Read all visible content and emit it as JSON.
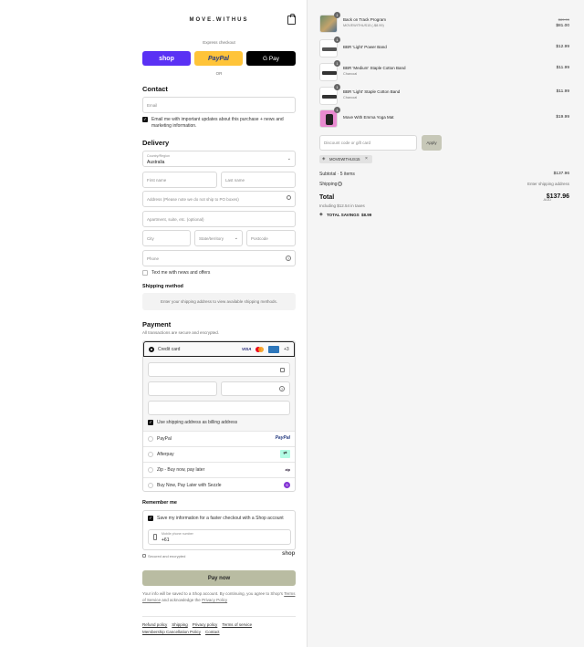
{
  "header": {
    "brand": "MOVE.WITHUS"
  },
  "express": {
    "label": "Express checkout",
    "shop_label": "shop",
    "paypal_label": "PayPal",
    "gpay_label": "G Pay",
    "or_label": "OR"
  },
  "contact": {
    "heading": "Contact",
    "email_placeholder": "Email",
    "news_label": "Email me with important updates about this purchase + news and marketing information."
  },
  "delivery": {
    "heading": "Delivery",
    "country_label": "Country/Region",
    "country_value": "Australia",
    "first_name": "First name",
    "last_name": "Last name",
    "address": "Address (Please note we do not ship to PO boxes)",
    "apartment": "Apartment, suite, etc. (optional)",
    "city": "City",
    "state": "State/territory",
    "postcode": "Postcode",
    "phone": "Phone",
    "text_label": "Text me with news and offers"
  },
  "shipping": {
    "heading": "Shipping method",
    "message": "Enter your shipping address to view available shipping methods."
  },
  "payment": {
    "heading": "Payment",
    "subtext": "All transactions are secure and encrypted.",
    "credit_card": "Credit card",
    "visa": "VISA",
    "more": "+3",
    "billing_label": "Use shipping address as billing address",
    "options": [
      {
        "label": "PayPal",
        "badge": "PayPal"
      },
      {
        "label": "Afterpay",
        "badge": "⇄"
      },
      {
        "label": "Zip - Buy now, pay later",
        "badge": "zip"
      },
      {
        "label": "Buy Now, Pay Later with Sezzle",
        "badge": "S"
      }
    ]
  },
  "remember": {
    "heading": "Remember me",
    "save_label": "Save my information for a faster checkout with a Shop account",
    "mobile_label": "Mobile phone number",
    "mobile_value": "+61",
    "secure_label": "Secured and encrypted",
    "shop_label": "shop"
  },
  "pay": {
    "button": "Pay now",
    "legal_1": "Your info will be saved to a Shop account. By continuing, you agree to Shop's",
    "terms_link": "Terms of Service",
    "legal_2": "and acknowledge the",
    "privacy_link": "Privacy Policy"
  },
  "footer": {
    "links": [
      "Refund policy",
      "Shipping",
      "Privacy policy",
      "Terms of service",
      "Membership Cancellation Policy",
      "Contact"
    ]
  },
  "cart": {
    "items": [
      {
        "qty": "1",
        "name": "Back on Track Program",
        "variant": "MOVEWITHUS15 (-$8.99)",
        "old_price": "$89.99",
        "price": "$81.00",
        "thumb_color": "#7a9a7a"
      },
      {
        "qty": "1",
        "name": "BBR 'Light' Power Band",
        "variant": "",
        "old_price": "",
        "price": "$12.99",
        "thumb_color": "#555555"
      },
      {
        "qty": "1",
        "name": "BBR 'Medium' Staple Cotton Band",
        "variant": "Charcoal",
        "old_price": "",
        "price": "$11.99",
        "thumb_color": "#333333"
      },
      {
        "qty": "1",
        "name": "BBR 'Light' Staple Cotton Band",
        "variant": "Charcoal",
        "old_price": "",
        "price": "$11.99",
        "thumb_color": "#333333"
      },
      {
        "qty": "1",
        "name": "Move With Emma Yoga Mat",
        "variant": "",
        "old_price": "",
        "price": "$19.99",
        "thumb_color": "#e88ad0"
      }
    ],
    "discount_placeholder": "Discount code or gift card",
    "apply_label": "Apply",
    "code_tag": "MOVEWITHUS15",
    "subtotal_label": "Subtotal · 5 items",
    "subtotal_value": "$137.96",
    "shipping_label": "Shipping",
    "shipping_value": "Enter shipping address",
    "total_label": "Total",
    "currency": "AUD",
    "total_value": "$137.96",
    "taxes": "Including $12.54 in taxes",
    "savings_label": "TOTAL SAVINGS",
    "savings_value": "$8.99"
  },
  "colors": {
    "shop_purple": "#5a31f4",
    "paypal_yellow": "#ffc439",
    "pay_button": "#b9bca2",
    "apply_button": "#c7c8b8"
  }
}
